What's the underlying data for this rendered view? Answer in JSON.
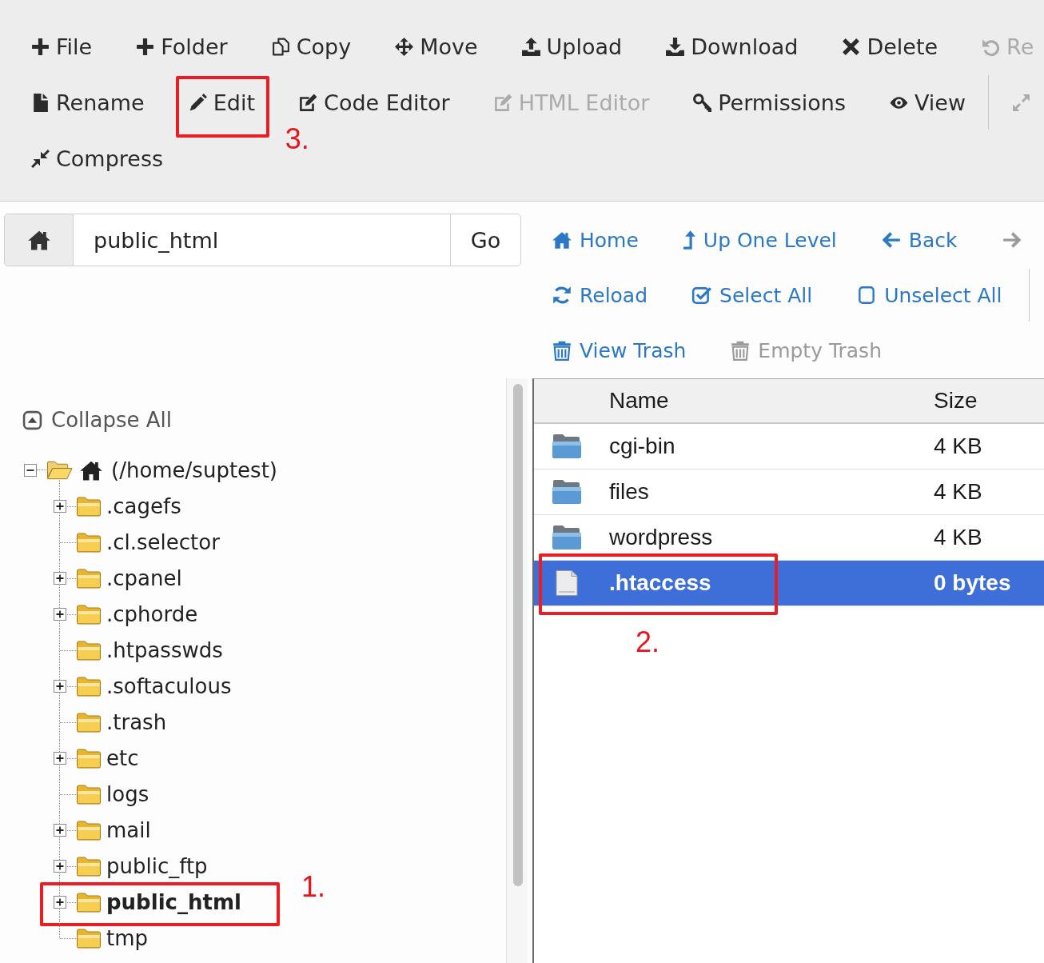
{
  "toolbar": {
    "items": [
      {
        "kind": "file",
        "label": "File",
        "disabled": false
      },
      {
        "kind": "folder",
        "label": "Folder",
        "disabled": false
      },
      {
        "kind": "copy",
        "label": "Copy",
        "disabled": false
      },
      {
        "kind": "move",
        "label": "Move",
        "disabled": false
      },
      {
        "kind": "upload",
        "label": "Upload",
        "disabled": false
      },
      {
        "kind": "download",
        "label": "Download",
        "disabled": false
      },
      {
        "kind": "delete",
        "label": "Delete",
        "disabled": false
      },
      {
        "kind": "restore",
        "label": "Re",
        "disabled": true
      },
      {
        "kind": "rename",
        "label": "Rename",
        "disabled": false
      },
      {
        "kind": "edit",
        "label": "Edit",
        "disabled": false,
        "callout": "3."
      },
      {
        "kind": "code-editor",
        "label": "Code Editor",
        "disabled": false
      },
      {
        "kind": "html-editor",
        "label": "HTML Editor",
        "disabled": true
      },
      {
        "kind": "permissions",
        "label": "Permissions",
        "disabled": false
      },
      {
        "kind": "view",
        "label": "View",
        "disabled": false
      },
      {
        "kind": "separator"
      },
      {
        "kind": "expand",
        "disabled": true
      },
      {
        "kind": "compress",
        "label": "Compress",
        "disabled": false
      }
    ]
  },
  "path_bar": {
    "value": "public_html",
    "go_label": "Go"
  },
  "nav": {
    "items": [
      {
        "kind": "home",
        "label": "Home",
        "disabled": false
      },
      {
        "kind": "up",
        "label": "Up One Level",
        "disabled": false
      },
      {
        "kind": "back",
        "label": "Back",
        "disabled": false
      },
      {
        "kind": "forward",
        "disabled": true
      },
      {
        "kind": "reload",
        "label": "Reload",
        "disabled": false
      },
      {
        "kind": "select-all",
        "label": "Select All",
        "disabled": false
      },
      {
        "kind": "unselect-all",
        "label": "Unselect All",
        "disabled": false
      },
      {
        "kind": "separator"
      },
      {
        "kind": "view-trash",
        "label": "View Trash",
        "disabled": false
      },
      {
        "kind": "empty-trash",
        "label": "Empty Trash",
        "disabled": true
      }
    ]
  },
  "collapse_all": {
    "label": "Collapse All"
  },
  "tree": [
    {
      "kind": "home",
      "label": "(/home/suptest)",
      "expandable": true,
      "expanded": true,
      "selected": false,
      "children": [
        {
          "kind": "folder",
          "label": ".cagefs",
          "expandable": true,
          "expanded": false,
          "selected": false
        },
        {
          "kind": "folder",
          "label": ".cl.selector",
          "expandable": false,
          "expanded": false,
          "selected": false
        },
        {
          "kind": "folder",
          "label": ".cpanel",
          "expandable": true,
          "expanded": false,
          "selected": false
        },
        {
          "kind": "folder",
          "label": ".cphorde",
          "expandable": true,
          "expanded": false,
          "selected": false
        },
        {
          "kind": "folder",
          "label": ".htpasswds",
          "expandable": false,
          "expanded": false,
          "selected": false
        },
        {
          "kind": "folder",
          "label": ".softaculous",
          "expandable": true,
          "expanded": false,
          "selected": false
        },
        {
          "kind": "folder",
          "label": ".trash",
          "expandable": false,
          "expanded": false,
          "selected": false
        },
        {
          "kind": "folder",
          "label": "etc",
          "expandable": true,
          "expanded": false,
          "selected": false
        },
        {
          "kind": "folder",
          "label": "logs",
          "expandable": false,
          "expanded": false,
          "selected": false
        },
        {
          "kind": "folder",
          "label": "mail",
          "expandable": true,
          "expanded": false,
          "selected": false
        },
        {
          "kind": "folder",
          "label": "public_ftp",
          "expandable": true,
          "expanded": false,
          "selected": false
        },
        {
          "kind": "folder",
          "label": "public_html",
          "expandable": true,
          "expanded": false,
          "selected": true,
          "callout": "1."
        },
        {
          "kind": "folder",
          "label": "tmp",
          "expandable": false,
          "expanded": false,
          "selected": false
        }
      ]
    }
  ],
  "file_table": {
    "columns": [
      "Name",
      "Size"
    ],
    "rows": [
      {
        "kind": "folder",
        "name": "cgi-bin",
        "size": "4 KB",
        "selected": false
      },
      {
        "kind": "folder",
        "name": "files",
        "size": "4 KB",
        "selected": false
      },
      {
        "kind": "folder",
        "name": "wordpress",
        "size": "4 KB",
        "selected": false
      },
      {
        "kind": "file",
        "name": ".htaccess",
        "size": "0 bytes",
        "selected": true,
        "callout": "2."
      }
    ]
  }
}
